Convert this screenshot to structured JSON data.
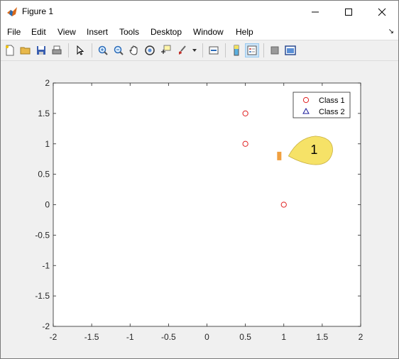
{
  "window": {
    "title": "Figure 1"
  },
  "menu": {
    "items": [
      "File",
      "Edit",
      "View",
      "Insert",
      "Tools",
      "Desktop",
      "Window",
      "Help"
    ],
    "overflow_icon": "corner-arrow-icon"
  },
  "toolbar": {
    "icons": [
      "new-figure-icon",
      "open-file-icon",
      "save-icon",
      "print-icon",
      "select-arrow-icon",
      "zoom-in-icon",
      "zoom-out-icon",
      "pan-hand-icon",
      "rotate-3d-icon",
      "data-cursor-icon",
      "brush-icon",
      "link-plot-icon",
      "colorbar-icon",
      "legend-icon",
      "hide-plot-tools-icon",
      "show-plot-tools-icon"
    ]
  },
  "chart_data": {
    "type": "scatter",
    "xlim": [
      -2,
      2
    ],
    "ylim": [
      -2,
      2
    ],
    "xticks": [
      "-2",
      "-1.5",
      "-1",
      "-0.5",
      "0",
      "0.5",
      "1",
      "1.5",
      "2"
    ],
    "yticks": [
      "2",
      "1.5",
      "1",
      "0.5",
      "0",
      "-0.5",
      "-1",
      "-1.5",
      "-2"
    ],
    "grid": false,
    "legend_position": "top-right",
    "series": [
      {
        "name": "Class 1",
        "marker": "circle",
        "color": "#e02020",
        "points": [
          [
            0.5,
            1.5
          ],
          [
            0.5,
            1
          ],
          [
            1,
            0
          ]
        ]
      },
      {
        "name": "Class 2",
        "marker": "triangle",
        "color": "#1a1a9a",
        "points": []
      }
    ],
    "annotations": [
      {
        "text": "1",
        "x": 0.95,
        "y": 0.8,
        "color": "#f5e05a"
      }
    ],
    "point_marker_color": "#f0a040"
  }
}
